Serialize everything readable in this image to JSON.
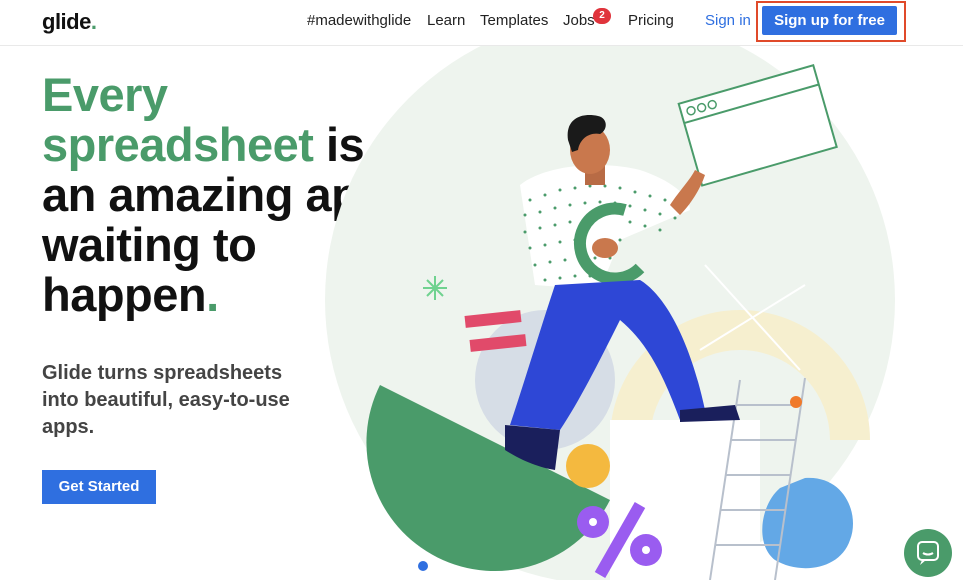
{
  "nav": {
    "logo_text": "glide",
    "logo_dot": ".",
    "links": [
      {
        "label": "#madewithglide"
      },
      {
        "label": "Learn"
      },
      {
        "label": "Templates"
      },
      {
        "label": "Jobs"
      },
      {
        "label": "Pricing"
      }
    ],
    "jobs_badge": "2",
    "signin_label": "Sign in",
    "signup_label": "Sign up for free"
  },
  "hero": {
    "headline_green": "Every spreadsheet",
    "headline_rest_1": " is",
    "headline_rest_2": "an amazing app waiting to happen",
    "headline_period": ".",
    "subtext": "Glide turns spreadsheets into beautiful, easy-to-use apps.",
    "cta_label": "Get Started"
  },
  "colors": {
    "brand_green": "#4a9b6a",
    "primary_blue": "#2f6fe0",
    "badge_red": "#e0343c",
    "highlight_outline": "#e04a2a"
  },
  "icons": {
    "chat": "chat-bubble-icon"
  }
}
